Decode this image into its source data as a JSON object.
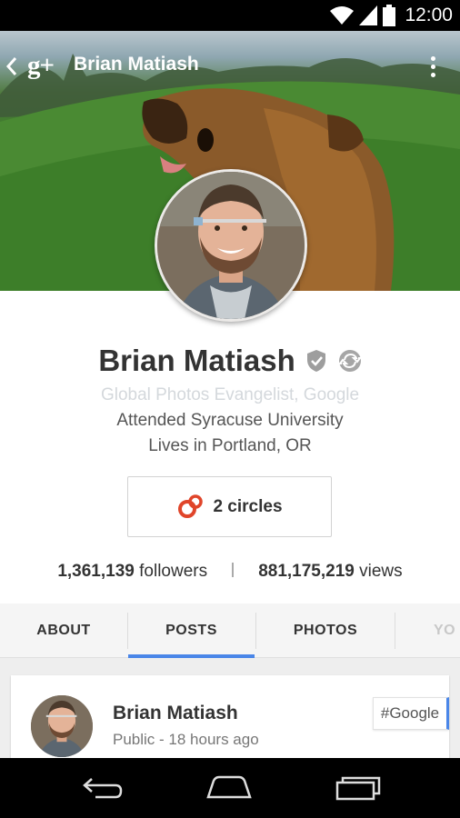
{
  "status_bar": {
    "time": "12:00",
    "icons": [
      "wifi-icon",
      "signal-icon",
      "battery-icon"
    ]
  },
  "app_bar": {
    "title": "Brian Matiash",
    "logo_text": "g+",
    "icons": [
      "back-chevron-icon",
      "overflow-menu-icon"
    ]
  },
  "profile": {
    "name": "Brian Matiash",
    "tagline": "Global Photos Evangelist, Google",
    "education": "Attended Syracuse University",
    "location": "Lives in Portland, OR",
    "badges": [
      "verified-shield-icon",
      "sync-icon"
    ]
  },
  "circles_button": {
    "label": "2 circles",
    "icon": "circles-icon",
    "icon_color": "#e0452a"
  },
  "stats": {
    "followers_count": "1,361,139",
    "followers_label": "followers",
    "views_count": "881,175,219",
    "views_label": "views"
  },
  "tabs": [
    {
      "label": "ABOUT"
    },
    {
      "label": "POSTS",
      "selected": true
    },
    {
      "label": "PHOTOS"
    },
    {
      "label": "YO"
    }
  ],
  "tab_accent": "#4a86e8",
  "post": {
    "author": "Brian Matiash",
    "meta": "Public - 18 hours ago",
    "hashtag": "#Google"
  },
  "nav_bar": {
    "icons": [
      "back-icon",
      "home-icon",
      "recents-icon"
    ]
  }
}
